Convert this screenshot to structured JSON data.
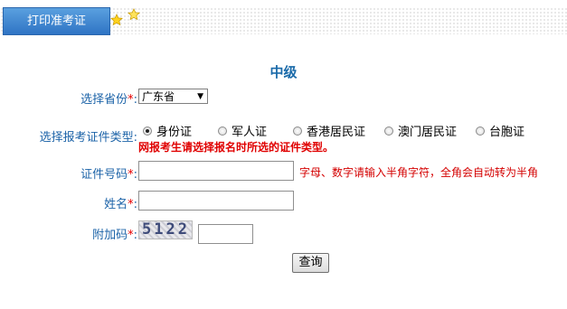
{
  "header": {
    "tab_label": "打印准考证",
    "star_icons": [
      "star-icon",
      "star-icon"
    ]
  },
  "form": {
    "title": "中级",
    "province": {
      "label": "选择省份",
      "required_mark": "*",
      "colon": ":",
      "selected": "广东省"
    },
    "id_type": {
      "label": "选择报考证件类型",
      "colon": ":",
      "options": [
        "身份证",
        "军人证",
        "香港居民证",
        "澳门居民证",
        "台胞证"
      ],
      "selected_index": 0,
      "note": "网报考生请选择报名时所选的证件类型。"
    },
    "id_number": {
      "label": "证件号码",
      "required_mark": "*",
      "colon": ":",
      "value": "",
      "hint": "字母、数字请输入半角字符，全角会自动转为半角"
    },
    "name": {
      "label": "姓名",
      "required_mark": "*",
      "colon": ":",
      "value": ""
    },
    "captcha": {
      "label": "附加码",
      "required_mark": "*",
      "colon": ":",
      "code": "5122",
      "value": ""
    },
    "submit_label": "查询"
  },
  "colors": {
    "label": "#1c63a8",
    "required": "#e60000",
    "tab_bg": "#3a82cf",
    "title": "#1a6aa9"
  }
}
